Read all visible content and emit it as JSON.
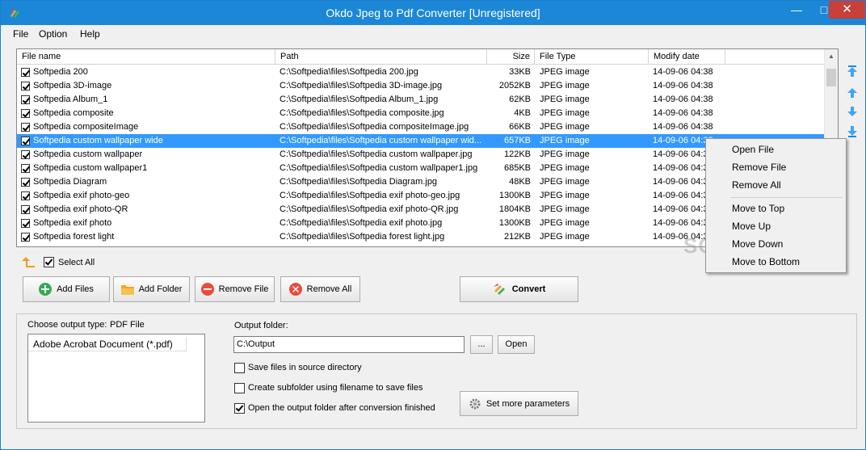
{
  "window": {
    "title": "Okdo Jpeg to Pdf Converter [Unregistered]"
  },
  "menubar": {
    "file": "File",
    "option": "Option",
    "help": "Help"
  },
  "list": {
    "headers": {
      "name": "File name",
      "path": "Path",
      "size": "Size",
      "type": "File Type",
      "modified": "Modify date"
    },
    "rows": [
      {
        "name": "Softpedia 200",
        "path": "C:\\Softpedia\\files\\Softpedia 200.jpg",
        "size": "33KB",
        "type": "JPEG image",
        "modified": "14-09-06 04:38",
        "checked": true,
        "selected": false
      },
      {
        "name": "Softpedia 3D-image",
        "path": "C:\\Softpedia\\files\\Softpedia 3D-image.jpg",
        "size": "2052KB",
        "type": "JPEG image",
        "modified": "14-09-06 04:38",
        "checked": true,
        "selected": false
      },
      {
        "name": "Softpedia Album_1",
        "path": "C:\\Softpedia\\files\\Softpedia Album_1.jpg",
        "size": "62KB",
        "type": "JPEG image",
        "modified": "14-09-06 04:38",
        "checked": true,
        "selected": false
      },
      {
        "name": "Softpedia composite",
        "path": "C:\\Softpedia\\files\\Softpedia composite.jpg",
        "size": "4KB",
        "type": "JPEG image",
        "modified": "14-09-06 04:38",
        "checked": true,
        "selected": false
      },
      {
        "name": "Softpedia compositeImage",
        "path": "C:\\Softpedia\\files\\Softpedia compositeImage.jpg",
        "size": "66KB",
        "type": "JPEG image",
        "modified": "14-09-06 04:38",
        "checked": true,
        "selected": false
      },
      {
        "name": "Softpedia custom wallpaper wide",
        "path": "C:\\Softpedia\\files\\Softpedia custom wallpaper wid...",
        "size": "657KB",
        "type": "JPEG image",
        "modified": "14-09-06 04:38",
        "checked": true,
        "selected": true
      },
      {
        "name": "Softpedia custom wallpaper",
        "path": "C:\\Softpedia\\files\\Softpedia custom wallpaper.jpg",
        "size": "122KB",
        "type": "JPEG image",
        "modified": "14-09-06 04:38",
        "checked": true,
        "selected": false
      },
      {
        "name": "Softpedia custom wallpaper1",
        "path": "C:\\Softpedia\\files\\Softpedia custom wallpaper1.jpg",
        "size": "685KB",
        "type": "JPEG image",
        "modified": "14-09-06 04:38",
        "checked": true,
        "selected": false
      },
      {
        "name": "Softpedia Diagram",
        "path": "C:\\Softpedia\\files\\Softpedia Diagram.jpg",
        "size": "48KB",
        "type": "JPEG image",
        "modified": "14-09-06 04:38",
        "checked": true,
        "selected": false
      },
      {
        "name": "Softpedia exif photo-geo",
        "path": "C:\\Softpedia\\files\\Softpedia exif photo-geo.jpg",
        "size": "1300KB",
        "type": "JPEG image",
        "modified": "14-09-06 04:38",
        "checked": true,
        "selected": false
      },
      {
        "name": "Softpedia exif photo-QR",
        "path": "C:\\Softpedia\\files\\Softpedia exif photo-QR.jpg",
        "size": "1804KB",
        "type": "JPEG image",
        "modified": "14-09-06 04:38",
        "checked": true,
        "selected": false
      },
      {
        "name": "Softpedia exif photo",
        "path": "C:\\Softpedia\\files\\Softpedia exif photo.jpg",
        "size": "1300KB",
        "type": "JPEG image",
        "modified": "14-09-06 04:38",
        "checked": true,
        "selected": false
      },
      {
        "name": "Softpedia forest light",
        "path": "C:\\Softpedia\\files\\Softpedia forest light.jpg",
        "size": "212KB",
        "type": "JPEG image",
        "modified": "14-09-06 04:38",
        "checked": true,
        "selected": false
      }
    ]
  },
  "select_all": {
    "label": "Select All",
    "checked": true
  },
  "buttons": {
    "add_files": "Add Files",
    "add_folder": "Add Folder",
    "remove_file": "Remove File",
    "remove_all": "Remove All",
    "convert": "Convert"
  },
  "output": {
    "type_label": "Choose output type:",
    "type_value": "PDF File",
    "formats": [
      "Adobe Acrobat Document (*.pdf)"
    ],
    "folder_label": "Output folder:",
    "folder_value": "C:\\Output",
    "browse": "...",
    "open": "Open",
    "save_in_source": "Save files in source directory",
    "create_subfolder": "Create subfolder using filename to save files",
    "open_after": "Open the output folder after conversion finished",
    "more_params": "Set more parameters"
  },
  "context_menu": {
    "open_file": "Open File",
    "remove_file": "Remove File",
    "remove_all": "Remove All",
    "move_to_top": "Move to Top",
    "move_up": "Move Up",
    "move_down": "Move Down",
    "move_to_bottom": "Move to Bottom"
  },
  "watermark": "SOFTPEDIA",
  "colors": {
    "titlebar": "#1c87d6",
    "selection": "#3399ff",
    "close": "#c7403a"
  }
}
